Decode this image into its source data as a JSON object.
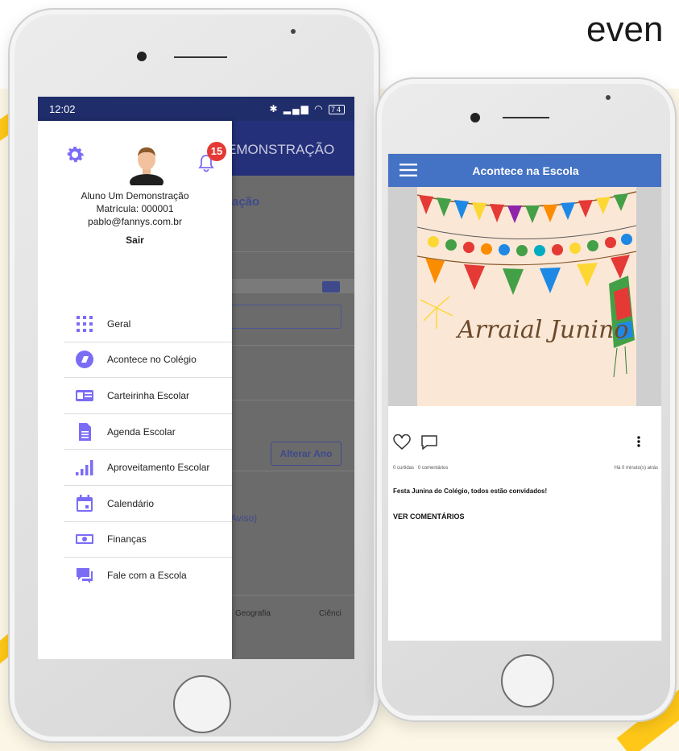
{
  "background": {
    "word": "even"
  },
  "left_phone": {
    "status": {
      "time": "12:02",
      "battery": "74"
    },
    "appbar_behind": {
      "title": "EMONSTRAÇÃO"
    },
    "behind_content": {
      "heading": "ação",
      "button": "Alterar Ano",
      "aviso": "Aviso)",
      "subject_1": "Geografia",
      "subject_2": "Ciênci"
    },
    "drawer": {
      "notifications": "15",
      "user": {
        "name": "Aluno Um Demonstração",
        "matricula": "Matrícula: 000001",
        "email": "pablo@fannys.com.br",
        "logout": "Sair"
      },
      "menu": [
        {
          "label": "Geral",
          "icon": "grid-icon"
        },
        {
          "label": "Acontece no Colégio",
          "icon": "news-icon"
        },
        {
          "label": "Carteirinha Escolar",
          "icon": "id-card-icon"
        },
        {
          "label": "Agenda Escolar",
          "icon": "document-icon"
        },
        {
          "label": "Aproveitamento Escolar",
          "icon": "bar-chart-icon"
        },
        {
          "label": "Calendário",
          "icon": "calendar-icon"
        },
        {
          "label": "Finanças",
          "icon": "money-icon"
        },
        {
          "label": "Fale com a Escola",
          "icon": "chat-icon"
        }
      ]
    }
  },
  "right_phone": {
    "appbar": {
      "title": "Acontece na Escola"
    },
    "post": {
      "image_text": "Arraial Junino",
      "likes": "0 curtidas",
      "comments_count": "0 comentários",
      "time": "Há 0 minuto(s) atrás",
      "caption": "Festa Junina do Colégio, todos estão convidados!",
      "view_comments": "VER COMENTÁRIOS"
    }
  },
  "colors": {
    "accent_purple": "#7b6cf6",
    "navy": "#25307a",
    "blue": "#4472c4",
    "badge_red": "#e53935",
    "yellow": "#ffc818"
  }
}
